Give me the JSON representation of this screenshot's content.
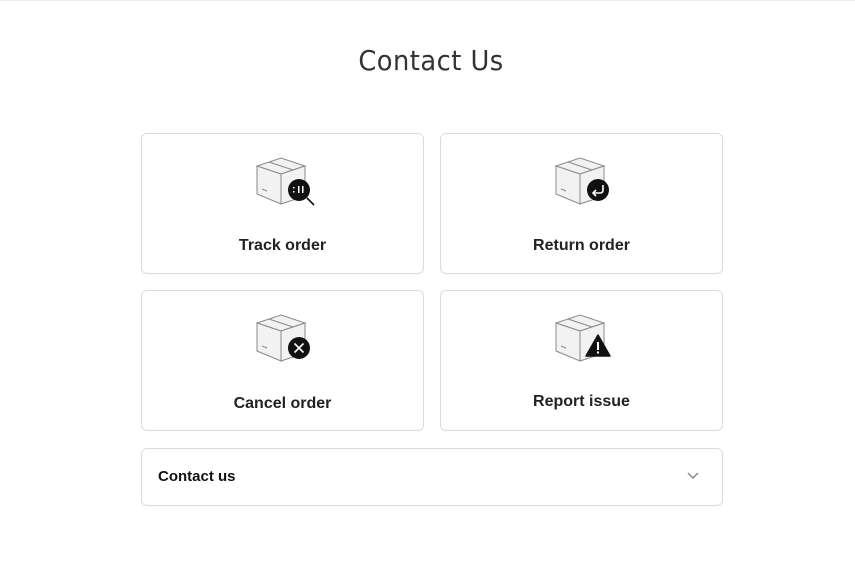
{
  "page": {
    "title": "Contact Us"
  },
  "cards": {
    "track": {
      "label": "Track order",
      "icon": "package-search-icon"
    },
    "return": {
      "label": "Return order",
      "icon": "package-return-icon"
    },
    "cancel": {
      "label": "Cancel order",
      "icon": "package-cancel-icon"
    },
    "report": {
      "label": "Report issue",
      "icon": "package-warning-icon"
    }
  },
  "contact": {
    "label": "Contact us",
    "icon": "chevron-down-icon"
  },
  "colors": {
    "border": "#dcdcdc",
    "text": "#222222",
    "badge": "#111111",
    "box_fill": "#f2f2f2",
    "box_stroke": "#8a8a8a"
  }
}
